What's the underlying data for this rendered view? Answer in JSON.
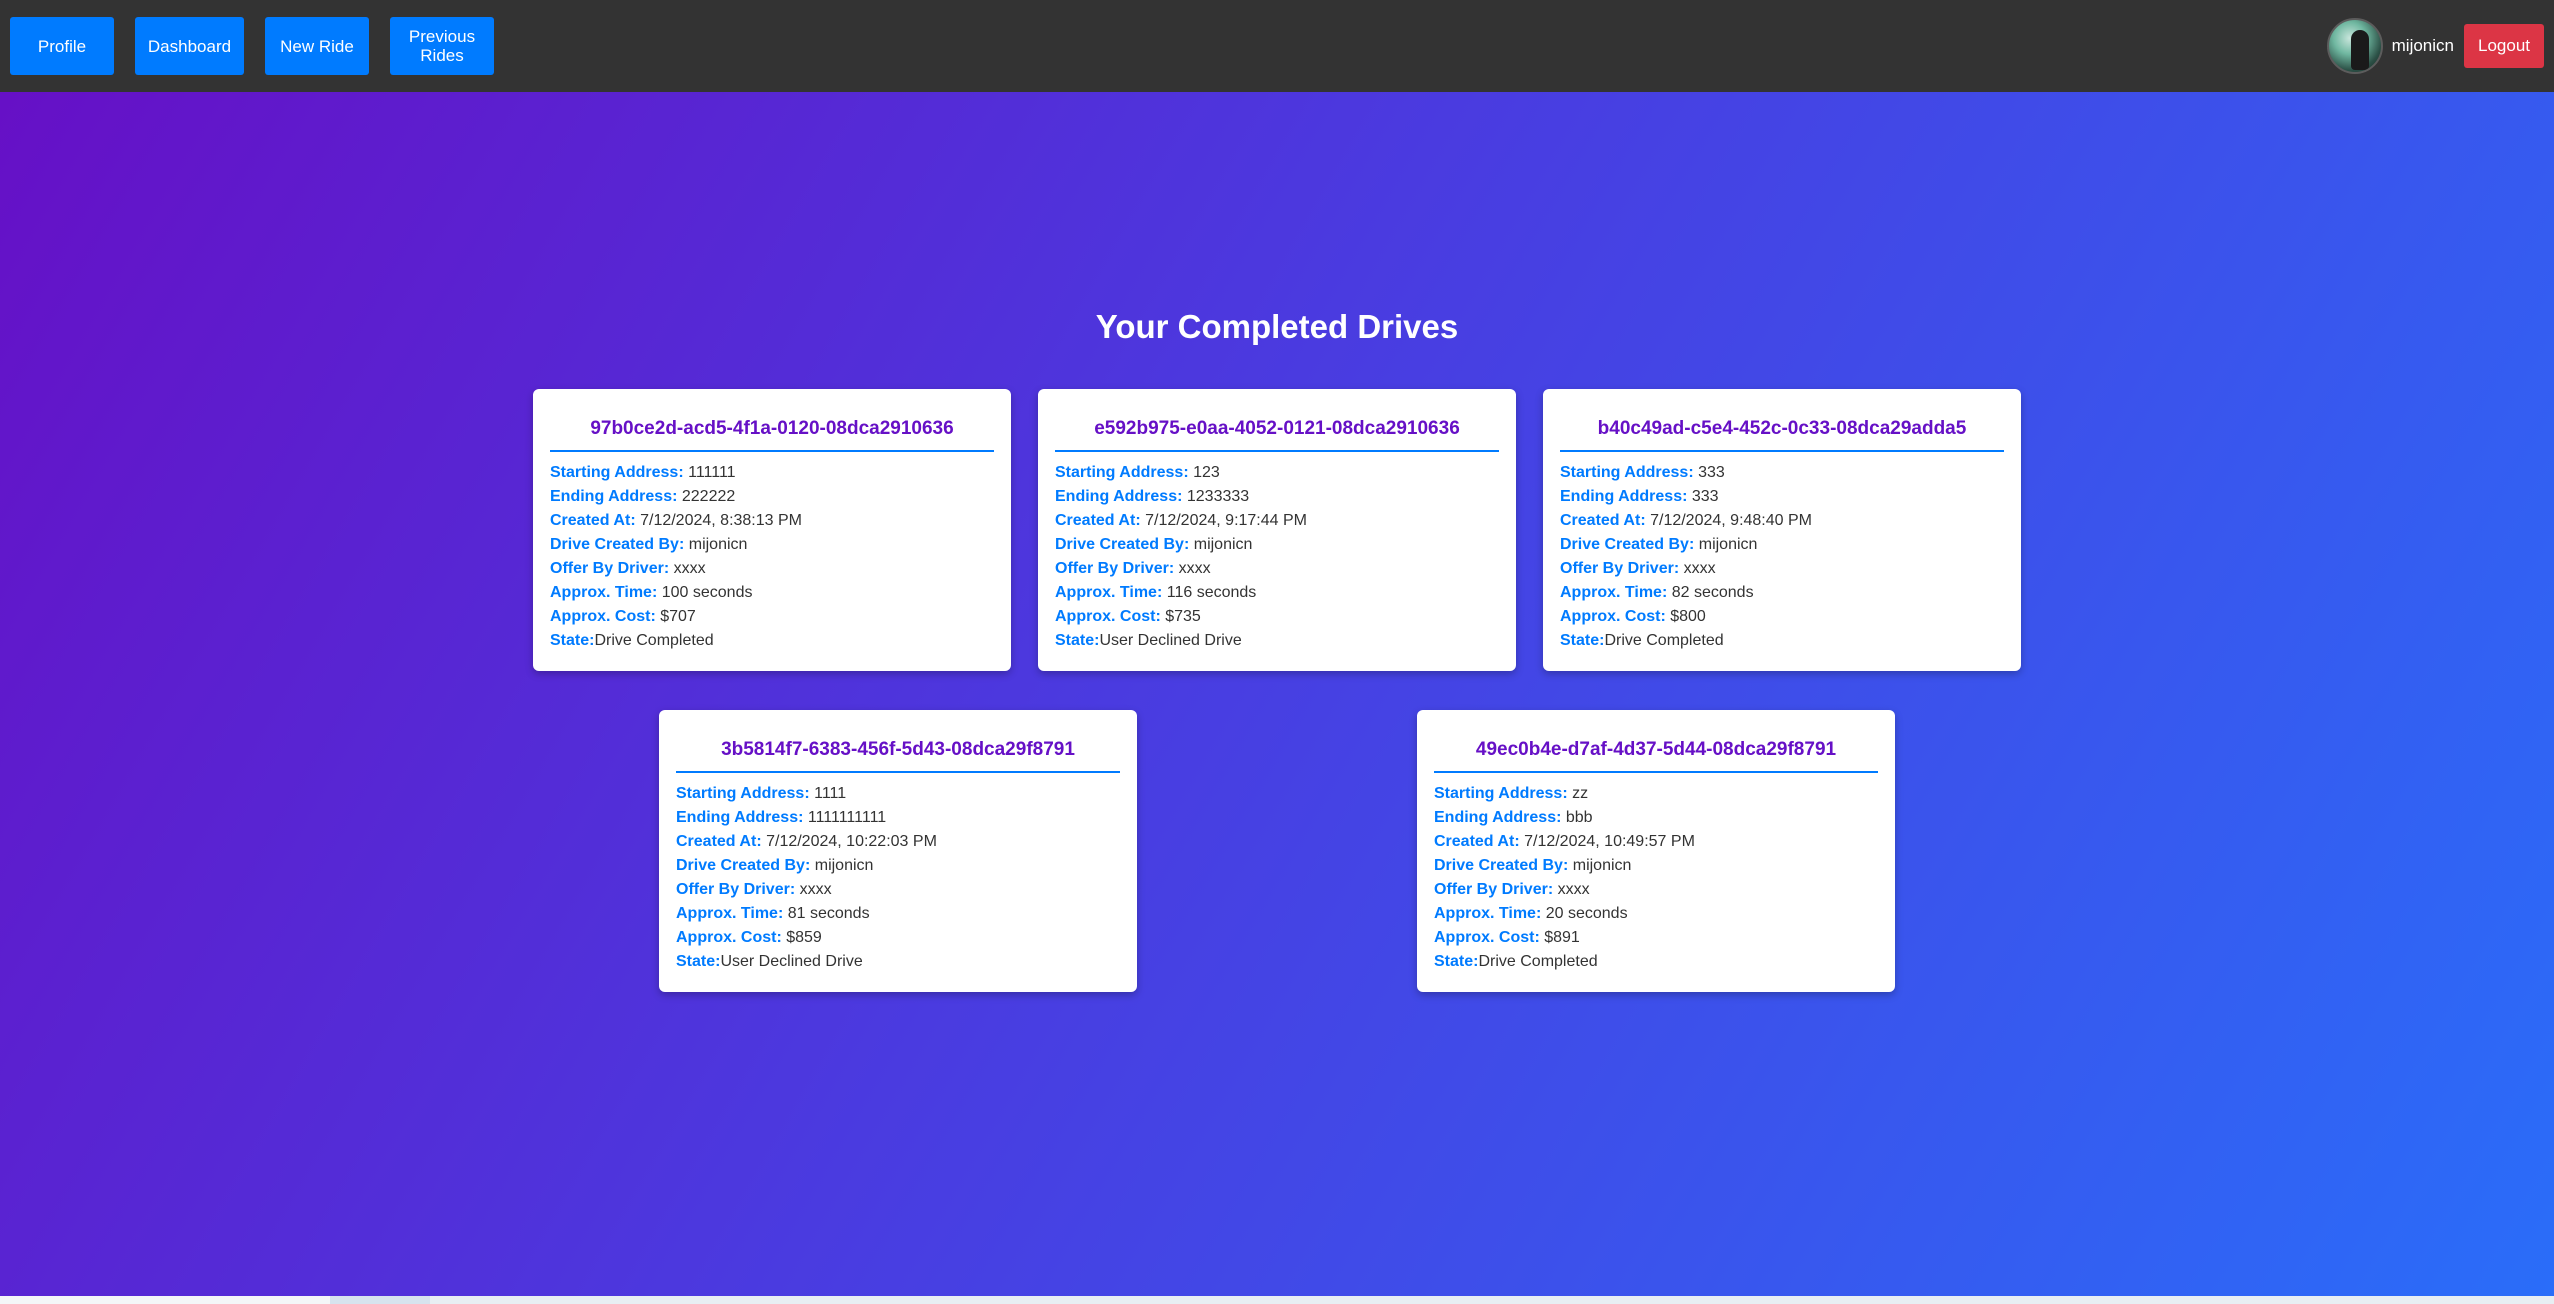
{
  "nav": {
    "buttons": [
      {
        "label": "Profile"
      },
      {
        "label": "Dashboard"
      },
      {
        "label": "New Ride"
      },
      {
        "label": "Previous Rides"
      }
    ],
    "username": "mijonicn",
    "logout_label": "Logout"
  },
  "page": {
    "title": "Your Completed Drives"
  },
  "labels": {
    "starting_address": "Starting Address:",
    "ending_address": "Ending Address:",
    "created_at": "Created At:",
    "drive_created_by": "Drive Created By:",
    "offer_by_driver": "Offer By Driver:",
    "approx_time": "Approx. Time:",
    "approx_cost": "Approx. Cost:",
    "state": "State:"
  },
  "drives": [
    {
      "id": "97b0ce2d-acd5-4f1a-0120-08dca2910636",
      "starting_address": "111111",
      "ending_address": "222222",
      "created_at": "7/12/2024, 8:38:13 PM",
      "drive_created_by": "mijonicn",
      "offer_by_driver": "xxxx",
      "approx_time": "100 seconds",
      "approx_cost": "$707",
      "state": "Drive Completed"
    },
    {
      "id": "e592b975-e0aa-4052-0121-08dca2910636",
      "starting_address": "123",
      "ending_address": "1233333",
      "created_at": "7/12/2024, 9:17:44 PM",
      "drive_created_by": "mijonicn",
      "offer_by_driver": "xxxx",
      "approx_time": "116 seconds",
      "approx_cost": "$735",
      "state": "User Declined Drive"
    },
    {
      "id": "b40c49ad-c5e4-452c-0c33-08dca29adda5",
      "starting_address": "333",
      "ending_address": "333",
      "created_at": "7/12/2024, 9:48:40 PM",
      "drive_created_by": "mijonicn",
      "offer_by_driver": "xxxx",
      "approx_time": "82 seconds",
      "approx_cost": "$800",
      "state": "Drive Completed"
    },
    {
      "id": "3b5814f7-6383-456f-5d43-08dca29f8791",
      "starting_address": "1111",
      "ending_address": "1111111111",
      "created_at": "7/12/2024, 10:22:03 PM",
      "drive_created_by": "mijonicn",
      "offer_by_driver": "xxxx",
      "approx_time": "81 seconds",
      "approx_cost": "$859",
      "state": "User Declined Drive"
    },
    {
      "id": "49ec0b4e-d7af-4d37-5d44-08dca29f8791",
      "starting_address": "zz",
      "ending_address": "bbb",
      "created_at": "7/12/2024, 10:49:57 PM",
      "drive_created_by": "mijonicn",
      "offer_by_driver": "xxxx",
      "approx_time": "20 seconds",
      "approx_cost": "$891",
      "state": "Drive Completed"
    }
  ],
  "colors": {
    "navbar_bg": "#333333",
    "nav_button": "#007bff",
    "logout_button": "#dc3545",
    "gradient_start": "#6610c6",
    "gradient_end": "#2a6df9",
    "card_id": "#6610c6",
    "label": "#007bff"
  },
  "icons": {
    "avatar": "user-avatar-photo"
  }
}
